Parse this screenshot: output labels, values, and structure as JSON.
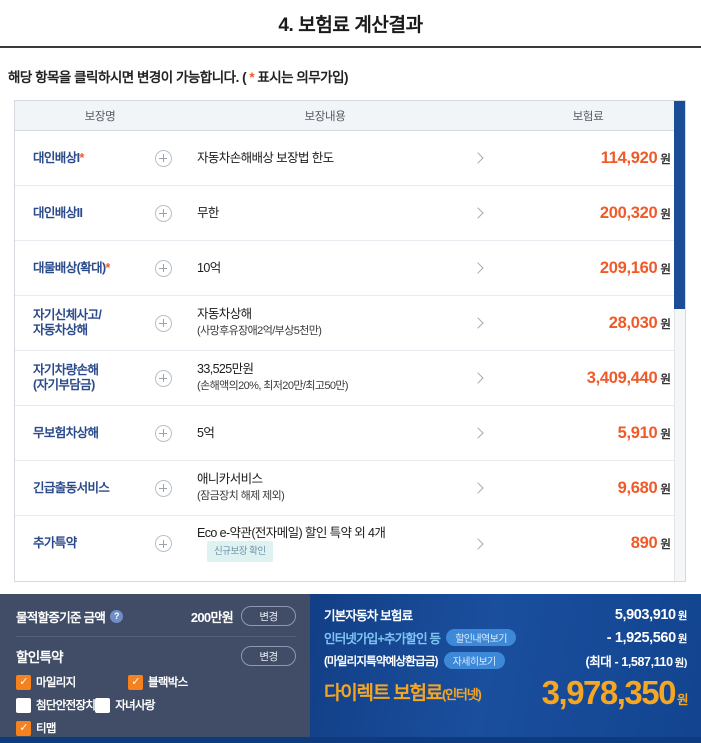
{
  "header": {
    "title": "4. 보험료 계산결과"
  },
  "notice": {
    "text_before": "해당 항목을 클릭하시면 변경이 가능합니다. ( ",
    "asterisk": "*",
    "text_after": " 표시는 의무가입)"
  },
  "table": {
    "columns": {
      "name": "보장명",
      "detail": "보장내용",
      "premium": "보험료"
    },
    "expand_icon": "plus-circle-icon",
    "arrow_icon": "chevron-right-icon",
    "unit": "원",
    "rows": [
      {
        "name": "대인배상I",
        "required": "*",
        "detail_main": "자동차손해배상 보장법 한도",
        "detail_sub": "",
        "badge": "",
        "premium": "114,920"
      },
      {
        "name": "대인배상II",
        "required": "",
        "detail_main": "무한",
        "detail_sub": "",
        "badge": "",
        "premium": "200,320"
      },
      {
        "name": "대물배상(확대)",
        "required": "*",
        "detail_main": "10억",
        "detail_sub": "",
        "badge": "",
        "premium": "209,160"
      },
      {
        "name": "자기신체사고/\n자동차상해",
        "required": "",
        "detail_main": "자동차상해",
        "detail_sub": "(사망후유장애2억/부상5천만)",
        "badge": "",
        "premium": "28,030"
      },
      {
        "name": "자기차량손해\n(자기부담금)",
        "required": "",
        "detail_main": "33,525만원",
        "detail_sub": "(손해액의20%, 최저20만/최고50만)",
        "badge": "",
        "premium": "3,409,440"
      },
      {
        "name": "무보험차상해",
        "required": "",
        "detail_main": "5억",
        "detail_sub": "",
        "badge": "",
        "premium": "5,910"
      },
      {
        "name": "긴급출동서비스",
        "required": "",
        "detail_main": "애니카서비스",
        "detail_sub": "(잠금장치 해제 제외)",
        "badge": "",
        "premium": "9,680"
      },
      {
        "name": "추가특약",
        "required": "",
        "detail_main": "Eco e-약관(전자메일) 할인 특약 외 4개",
        "detail_sub": "",
        "badge": "신규보장 확인",
        "premium": "890"
      }
    ]
  },
  "options_panel": {
    "surcharge_label": "물적할증기준 금액",
    "help_icon": "question-mark-icon",
    "surcharge_value": "200만원",
    "surcharge_change_label": "변경",
    "discount_label": "할인특약",
    "discount_change_label": "변경",
    "checkboxes": [
      {
        "label": "마일리지",
        "checked": true
      },
      {
        "label": "블랙박스",
        "checked": true
      },
      {
        "label": "첨단안전장치",
        "checked": false
      },
      {
        "label": "자녀사랑",
        "checked": false
      },
      {
        "label": "티맵",
        "checked": true
      }
    ]
  },
  "summary_panel": {
    "base_label": "기본자동차 보험료",
    "base_amount": "5,903,910",
    "base_unit": "원",
    "discount_label": "인터넷가입+추가할인 등",
    "discount_pill": "할인내역보기",
    "discount_amount": "- 1,925,560",
    "discount_unit": "원",
    "refund_label": "(마일리지특약예상환급금)",
    "refund_pill": "자세히보기",
    "refund_amount": "(최대 - 1,587,110",
    "refund_unit": "원)",
    "total_label": "다이렉트 보험료",
    "total_label_sub": "(인터넷)",
    "total_amount": "3,978,350",
    "total_unit": "원"
  },
  "colors": {
    "accent_orange": "#f05a28",
    "link_blue": "#2a4a8b",
    "panel_left_bg": "#414d66",
    "panel_right_bg": "#1a4f9e",
    "gold": "#f5a623",
    "check_on": "#f6821f"
  }
}
